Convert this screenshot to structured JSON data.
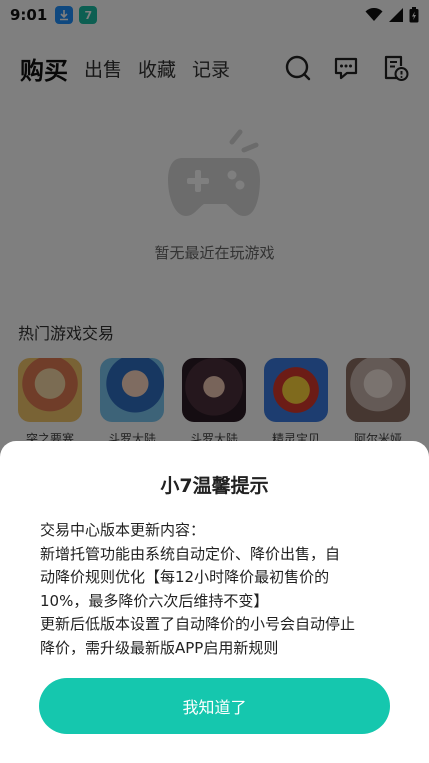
{
  "status_bar": {
    "time": "9:01",
    "app_icon_1": "download-icon",
    "app_icon_2_label": "7",
    "accent_icon_color": "#1e90ff",
    "app_icon_2_color": "#1bbfa5"
  },
  "header": {
    "tabs": [
      {
        "label": "购买",
        "active": true
      },
      {
        "label": "出售",
        "active": false
      },
      {
        "label": "收藏",
        "active": false
      },
      {
        "label": "记录",
        "active": false
      }
    ],
    "icons": [
      "search-icon",
      "message-icon",
      "record-alert-icon"
    ]
  },
  "empty_state": {
    "icon": "gamepad-icon",
    "text": "暂无最近在玩游戏"
  },
  "hot_games": {
    "title": "热门游戏交易",
    "items": [
      {
        "name": "突之要塞"
      },
      {
        "name": "斗罗大陆"
      },
      {
        "name": "斗罗大陆"
      },
      {
        "name": "精灵宝贝"
      },
      {
        "name": "阿尔米娅"
      }
    ]
  },
  "dialog": {
    "title": "小7温馨提示",
    "lines": [
      "交易中心版本更新内容：",
      "新增托管功能由系统自动定价、降价出售，自",
      "动降价规则优化【每12小时降价最初售价的",
      "10%，最多降价六次后维持不变】",
      "更新后低版本设置了自动降价的小号会自动停止",
      "降价，需升级最新版APP启用新规则"
    ],
    "confirm_label": "我知道了",
    "confirm_color": "#15c7ae"
  }
}
